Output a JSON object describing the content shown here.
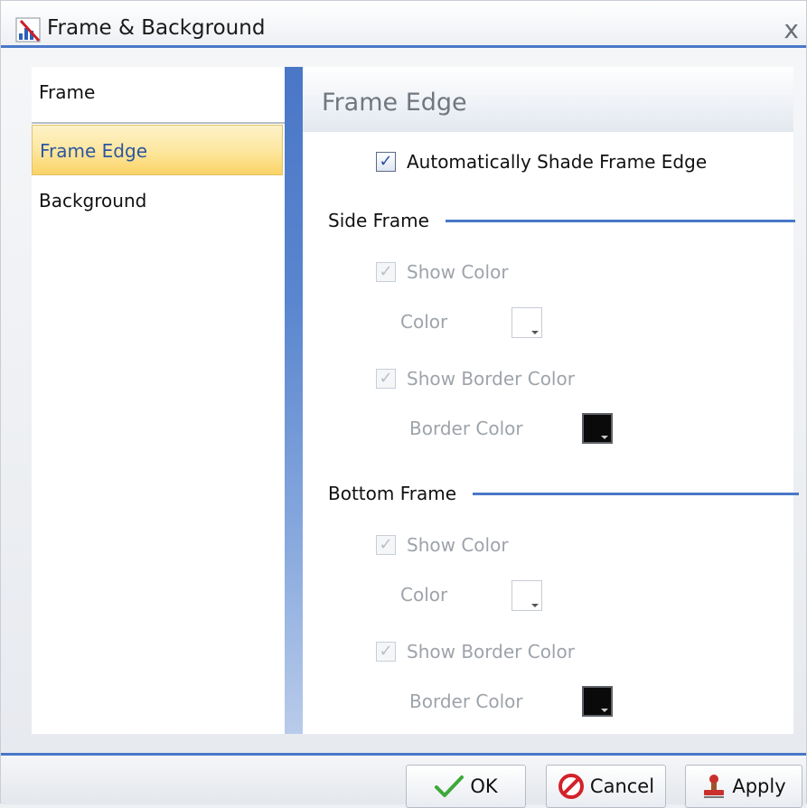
{
  "window": {
    "title": "Frame & Background",
    "close_glyph": "x",
    "icon": "chart-edit-icon"
  },
  "nav": {
    "items": [
      {
        "label": "Frame"
      },
      {
        "label": "Frame Edge",
        "selected": true
      },
      {
        "label": "Background"
      }
    ]
  },
  "content": {
    "title": "Frame Edge",
    "auto_shade": {
      "label": "Automatically Shade Frame Edge",
      "checked": true,
      "enabled": true
    },
    "side_frame": {
      "heading": "Side Frame",
      "show_color": {
        "label": "Show Color",
        "checked": true,
        "enabled": false
      },
      "color": {
        "label": "Color",
        "value": "#ffffff"
      },
      "show_border_color": {
        "label": "Show Border Color",
        "checked": true,
        "enabled": false
      },
      "border_color": {
        "label": "Border Color",
        "value": "#000000"
      }
    },
    "bottom_frame": {
      "heading": "Bottom Frame",
      "show_color": {
        "label": "Show Color",
        "checked": true,
        "enabled": false
      },
      "color": {
        "label": "Color",
        "value": "#ffffff"
      },
      "show_border_color": {
        "label": "Show Border Color",
        "checked": true,
        "enabled": false
      },
      "border_color": {
        "label": "Border Color",
        "value": "#000000"
      }
    }
  },
  "buttons": {
    "ok": {
      "label": "OK",
      "icon": "checkmark-icon"
    },
    "cancel": {
      "label": "Cancel",
      "icon": "cancel-icon"
    },
    "apply": {
      "label": "Apply",
      "icon": "apply-stamp-icon"
    }
  },
  "colors": {
    "accent": "#4a78c8",
    "selection": "#fde7a0",
    "disabled_text": "#9ea3aa"
  }
}
